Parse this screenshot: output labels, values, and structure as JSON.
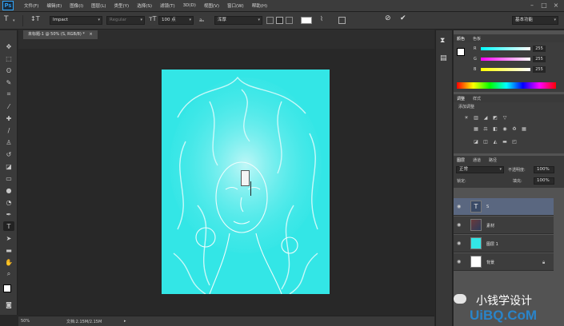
{
  "app": {
    "logo": "Ps"
  },
  "menu": [
    "文件(F)",
    "编辑(E)",
    "图像(I)",
    "图层(L)",
    "类型(Y)",
    "选择(S)",
    "滤镜(T)",
    "3D(D)",
    "视图(V)",
    "窗口(W)",
    "帮助(H)"
  ],
  "options": {
    "font_family": "Impact",
    "font_style": "Regular",
    "font_size": "100 点",
    "antialias": "浑厚",
    "workspace": "基本功能"
  },
  "document": {
    "tab_title": "未标题-1 @ 50% (S, RGB/8) *",
    "canvas_color": "#33e6e6",
    "zoom": "50%",
    "doc_size": "文档:2.15M/2.15M"
  },
  "color_panel": {
    "tabs": [
      "颜色",
      "色板"
    ],
    "channels": [
      {
        "label": "R",
        "value": "255"
      },
      {
        "label": "G",
        "value": "255"
      },
      {
        "label": "B",
        "value": "255"
      }
    ]
  },
  "adjust_panel": {
    "tabs": [
      "调整",
      "样式"
    ],
    "title": "添加调整"
  },
  "layers_panel": {
    "tabs": [
      "图层",
      "通道",
      "路径"
    ],
    "blend_mode": "正常",
    "opacity_label": "不透明度:",
    "opacity_value": "100%",
    "lock_label": "锁定:",
    "fill_label": "填充:",
    "fill_value": "100%",
    "layers": [
      {
        "name": "S",
        "kind": "text-layer",
        "selected": true
      },
      {
        "name": "素材",
        "kind": "image-layer",
        "selected": false
      },
      {
        "name": "图层 1",
        "kind": "fill-layer",
        "selected": false
      },
      {
        "name": "背景",
        "kind": "background-layer",
        "selected": false
      }
    ]
  },
  "watermark": {
    "brand": "小钱学设计",
    "site": "UiBQ.CoM"
  },
  "colors": {
    "accent": "#31a8ff",
    "selected_layer": "#5a6780",
    "canvas": "#33e6e6"
  }
}
